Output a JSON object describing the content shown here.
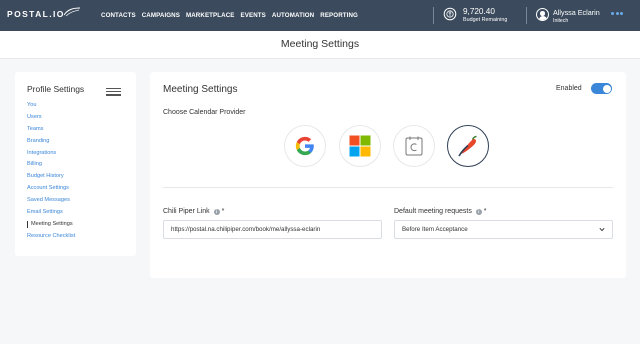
{
  "nav": {
    "logo": "POSTAL.IO",
    "links": [
      "CONTACTS",
      "CAMPAIGNS",
      "MARKETPLACE",
      "EVENTS",
      "AUTOMATION",
      "REPORTING"
    ],
    "budget_amount": "9,720.40",
    "budget_label": "Budget Remaining",
    "user_name": "Allyssa Eclarin",
    "user_org": "Initech"
  },
  "page": {
    "title": "Meeting Settings"
  },
  "sidebar": {
    "title": "Profile Settings",
    "items": [
      {
        "label": "You",
        "active": false
      },
      {
        "label": "Users",
        "active": false
      },
      {
        "label": "Teams",
        "active": false
      },
      {
        "label": "Branding",
        "active": false
      },
      {
        "label": "Integrations",
        "active": false
      },
      {
        "label": "Billing",
        "active": false
      },
      {
        "label": "Budget History",
        "active": false
      },
      {
        "label": "Account Settings",
        "active": false
      },
      {
        "label": "Saved Messages",
        "active": false
      },
      {
        "label": "Email Settings",
        "active": false
      },
      {
        "label": "Meeting Settings",
        "active": true
      },
      {
        "label": "Resource Checklist",
        "active": false
      }
    ]
  },
  "panel": {
    "title": "Meeting Settings",
    "enabled_label": "Enabled",
    "enabled": true,
    "choose_label": "Choose Calendar Provider",
    "providers": [
      {
        "name": "google-icon",
        "selected": false
      },
      {
        "name": "microsoft-icon",
        "selected": false
      },
      {
        "name": "calendar-icon",
        "selected": false
      },
      {
        "name": "chili-piper-icon",
        "selected": true
      }
    ],
    "link_label": "Chili Piper Link",
    "link_value": "https://postal.na.chilipiper.com/book/me/allyssa-eclarin",
    "requests_label": "Default meeting requests",
    "requests_value": "Before Item Acceptance",
    "info_symbol": "i",
    "required_mark": "*"
  },
  "colors": {
    "nav_bg": "#3b4a5c",
    "accent": "#3a86d8",
    "page_bg": "#f6f7f9"
  }
}
